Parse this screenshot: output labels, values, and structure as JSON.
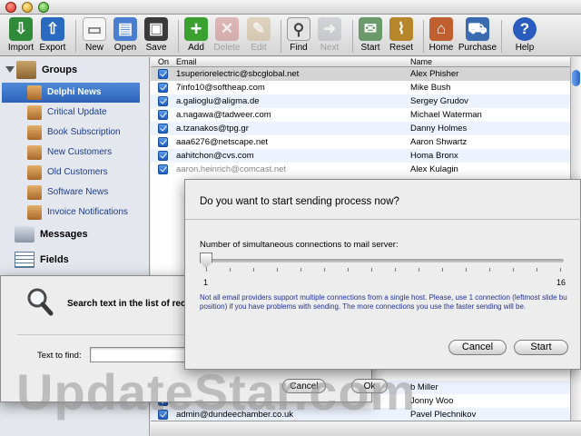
{
  "toolbar": {
    "buttons": [
      {
        "label": "Import",
        "icon": "import-icon",
        "color": "#2f8a3a",
        "glyph": "⇩"
      },
      {
        "label": "Export",
        "icon": "export-icon",
        "color": "#2a6ac0",
        "glyph": "⇧"
      },
      {
        "label": "New",
        "icon": "new-document-icon",
        "color": "#e8e8e8",
        "glyph": "▭"
      },
      {
        "label": "Open",
        "icon": "folder-icon",
        "color": "#4a7ed0",
        "glyph": "▤"
      },
      {
        "label": "Save",
        "icon": "floppy-disk-icon",
        "color": "#3a3a3a",
        "glyph": "▣"
      },
      {
        "label": "Add",
        "icon": "plus-icon",
        "color": "#3aa030",
        "glyph": "+"
      },
      {
        "label": "Delete",
        "icon": "x-mark-icon",
        "color": "#c05050",
        "glyph": "✕"
      },
      {
        "label": "Edit",
        "icon": "pencil-icon",
        "color": "#c0a060",
        "glyph": "✎"
      },
      {
        "label": "Find",
        "icon": "magnifier-icon",
        "color": "#9aa0a8",
        "glyph": "⚲"
      },
      {
        "label": "Next",
        "icon": "next-arrow-icon",
        "color": "#9aa0a8",
        "glyph": "➜"
      },
      {
        "label": "Start",
        "icon": "send-envelope-icon",
        "color": "#6a9a6a",
        "glyph": "✉"
      },
      {
        "label": "Reset",
        "icon": "broom-icon",
        "color": "#b8862a",
        "glyph": "⌇"
      },
      {
        "label": "Home",
        "icon": "house-icon",
        "color": "#c06030",
        "glyph": "⌂"
      },
      {
        "label": "Purchase",
        "icon": "shopping-cart-icon",
        "color": "#3a6ab0",
        "glyph": "⛟"
      },
      {
        "label": "Help",
        "icon": "help-icon",
        "color": "#2a5cc0",
        "glyph": "?"
      }
    ]
  },
  "sidebar": {
    "groups_label": "Groups",
    "items": [
      {
        "label": "Delphi News"
      },
      {
        "label": "Critical Update"
      },
      {
        "label": "Book Subscription"
      },
      {
        "label": "New Customers"
      },
      {
        "label": "Old Customers"
      },
      {
        "label": "Software News"
      },
      {
        "label": "Invoice Notifications"
      }
    ],
    "messages_label": "Messages",
    "fields_label": "Fields"
  },
  "table": {
    "col_on": "On",
    "col_email": "Email",
    "col_name": "Name",
    "rows": [
      {
        "email": "1superiorelectric@sbcglobal.net",
        "name": "Alex Phisher"
      },
      {
        "email": "7info10@softheap.com",
        "name": "Mike Bush"
      },
      {
        "email": "a.galioglu@aligma.de",
        "name": "Sergey Grudov"
      },
      {
        "email": "a.nagawa@tadweer.com",
        "name": "Michael Waterman"
      },
      {
        "email": "a.tzanakos@tpg.gr",
        "name": "Danny Holmes"
      },
      {
        "email": "aaa6276@netscape.net",
        "name": "Aaron Shwartz"
      },
      {
        "email": "aahitchon@cvs.com",
        "name": "Homa Bronx"
      },
      {
        "email": "aaron.heinrich@comcast.net",
        "name": "Alex Kulagin"
      }
    ],
    "bottom_rows": [
      {
        "email": "",
        "name": "b Miller"
      },
      {
        "email": "",
        "name": "Jonny Woo"
      },
      {
        "email": "admin@dundeechamber.co.uk",
        "name": "Pavel Plechnikov"
      }
    ]
  },
  "send_dialog": {
    "question": "Do you want to start sending process now?",
    "slider_label": "Number of simultaneous connections to mail server:",
    "slider_min": "1",
    "slider_max": "16",
    "slider_value": 1,
    "note": "Not all email providers support multiple connections from a single host. Please, use 1 connection (leftmost slide bu position) if you have problems with sending. The more connections you use the faster sending will be.",
    "cancel": "Cancel",
    "start": "Start"
  },
  "find_dialog": {
    "title": "Search text in the list of rec",
    "field_label": "Text to find:",
    "field_value": "",
    "cancel": "Cancel",
    "ok": "Ok"
  },
  "watermark": "UpdateStar.com"
}
